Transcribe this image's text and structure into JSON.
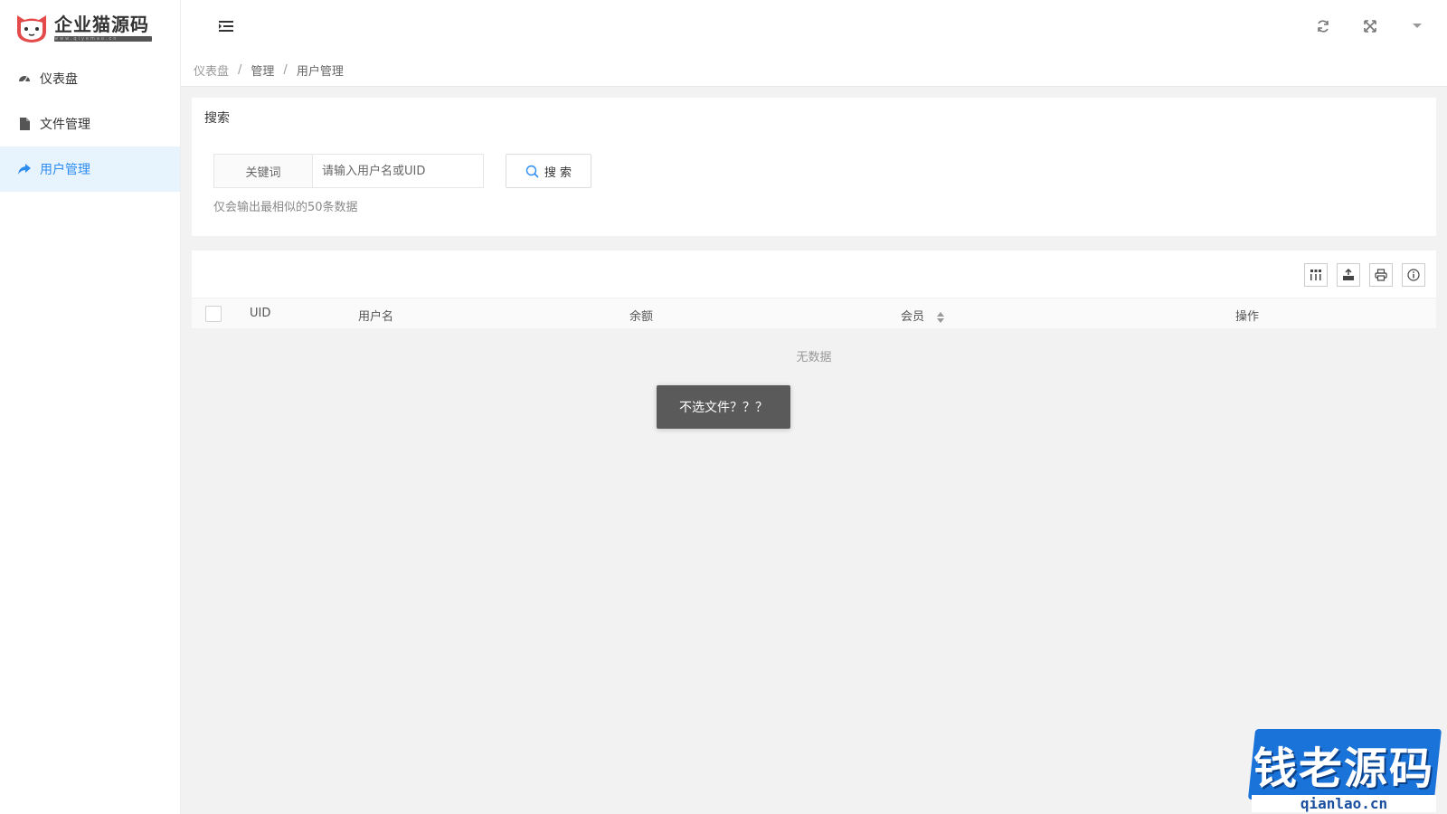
{
  "app": {
    "logo_text": "企业猫源码",
    "logo_sub": "www.qiyemao.cn",
    "accent_color": "#2d8cf0"
  },
  "sidebar": {
    "items": [
      {
        "label": "仪表盘",
        "icon": "dashboard-icon",
        "active": false
      },
      {
        "label": "文件管理",
        "icon": "file-icon",
        "active": false
      },
      {
        "label": "用户管理",
        "icon": "share-arrow-icon",
        "active": true
      }
    ]
  },
  "header": {
    "actions": [
      "refresh-icon",
      "fullscreen-icon",
      "dropdown-caret-icon"
    ]
  },
  "breadcrumb": [
    "仪表盘",
    "管理",
    "用户管理"
  ],
  "search": {
    "title": "搜索",
    "label": "关键词",
    "placeholder": "请输入用户名或UID",
    "button": "搜 索",
    "hint": "仅会输出最相似的50条数据"
  },
  "table": {
    "toolbar": [
      "columns-icon",
      "export-icon",
      "print-icon",
      "info-icon"
    ],
    "columns": [
      "UID",
      "用户名",
      "余额",
      "会员",
      "操作"
    ],
    "empty_text": "无数据"
  },
  "toast": "不选文件？？？",
  "watermark": {
    "text": "钱老源码",
    "url": "qianlao.cn"
  }
}
